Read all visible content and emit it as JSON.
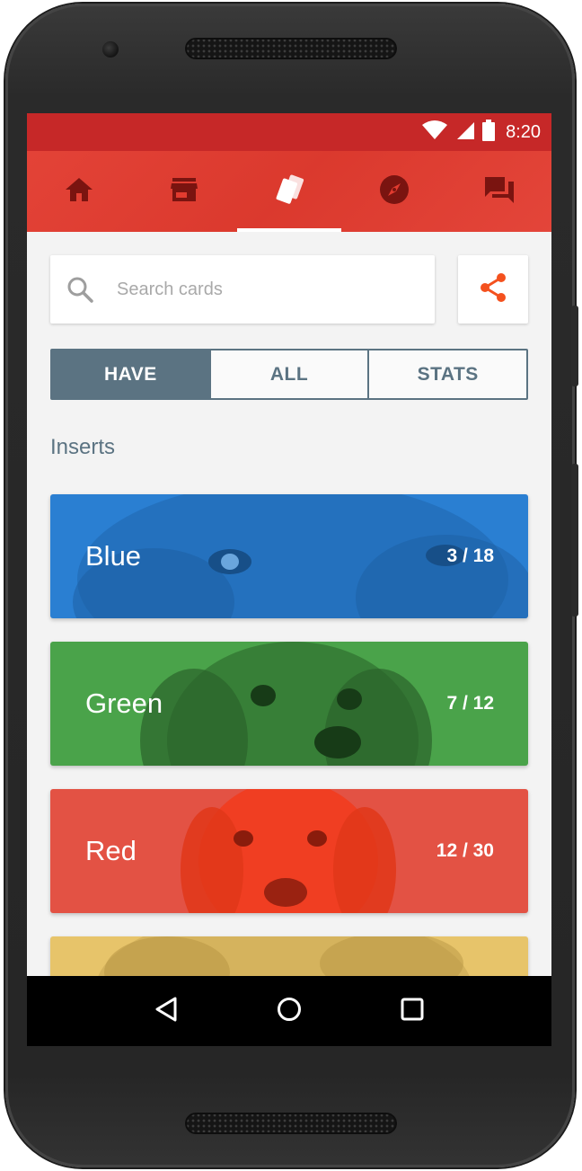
{
  "status_bar": {
    "time": "8:20"
  },
  "nav_tabs": [
    {
      "icon": "home-icon",
      "active": false
    },
    {
      "icon": "store-icon",
      "active": false
    },
    {
      "icon": "cards-icon",
      "active": true
    },
    {
      "icon": "compass-icon",
      "active": false
    },
    {
      "icon": "forum-icon",
      "active": false
    }
  ],
  "search": {
    "placeholder": "Search cards",
    "value": ""
  },
  "segments": {
    "have": "HAVE",
    "all": "ALL",
    "stats": "STATS",
    "active": "HAVE"
  },
  "section": {
    "title": "Inserts"
  },
  "cards": [
    {
      "name": "Blue",
      "count": "3 / 18",
      "color": "#2a7fd2"
    },
    {
      "name": "Green",
      "count": "7 / 12",
      "color": "#4aa34a"
    },
    {
      "name": "Red",
      "count": "12 / 30",
      "color": "#e35244"
    },
    {
      "name": "",
      "count": "",
      "color": "#e7c46a"
    }
  ],
  "colors": {
    "status_bar": "#c62828",
    "app_bar": "#e23b2f",
    "accent": "#f4511e",
    "segment": "#5b7382"
  }
}
